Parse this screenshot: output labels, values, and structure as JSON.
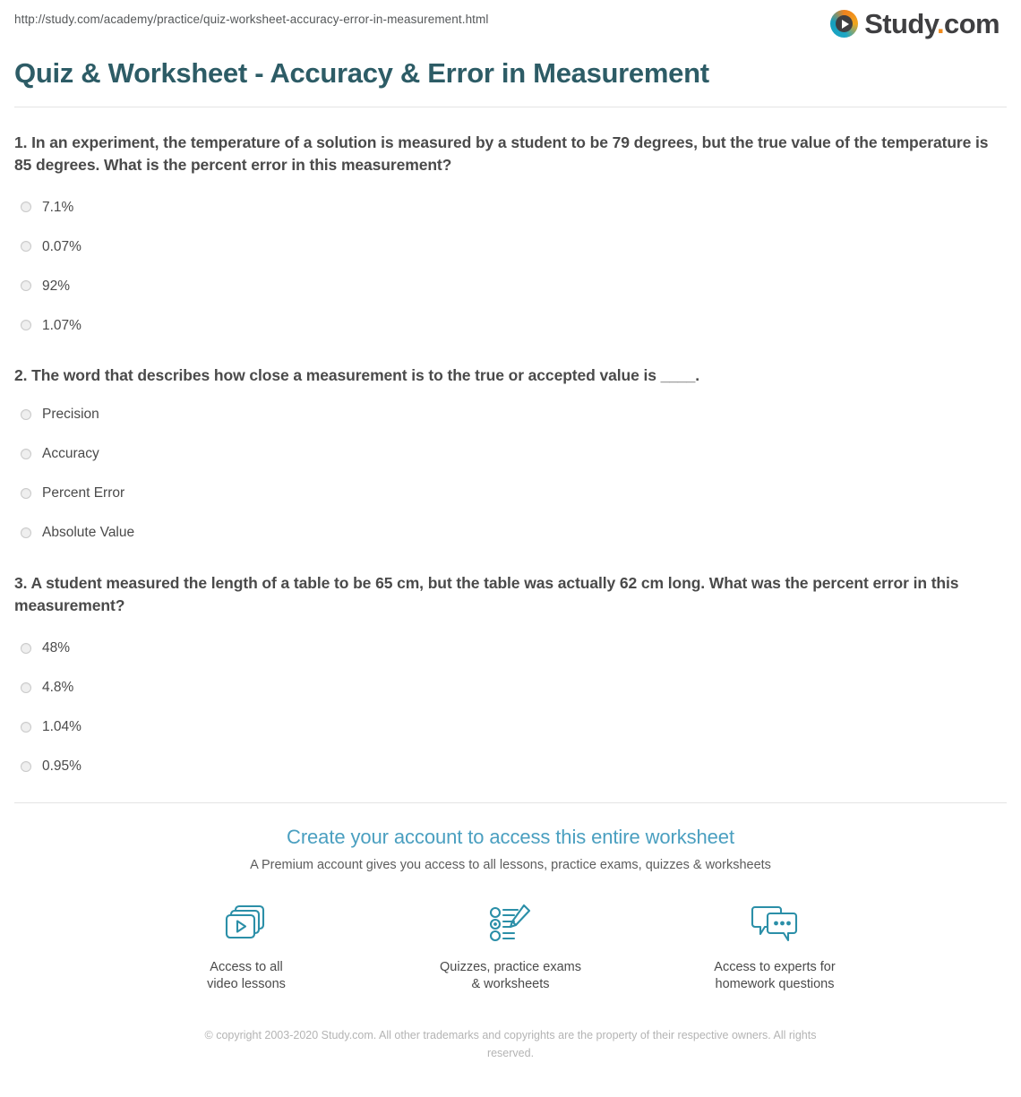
{
  "header": {
    "url": "http://study.com/academy/practice/quiz-worksheet-accuracy-error-in-measurement.html",
    "logo": {
      "icon": "play-circle-icon",
      "word": "Study",
      "dot": ".",
      "com": "com"
    }
  },
  "page_title": "Quiz & Worksheet - Accuracy & Error in Measurement",
  "questions": [
    {
      "text": "1. In an experiment, the temperature of a solution is measured by a student to be 79 degrees, but the true value of the temperature is 85 degrees. What is the percent error in this measurement?",
      "options": [
        "7.1%",
        "0.07%",
        "92%",
        "1.07%"
      ]
    },
    {
      "text": "2. The word that describes how close a measurement is to the true or accepted value is ____.",
      "options": [
        "Precision",
        "Accuracy",
        "Percent Error",
        "Absolute Value"
      ]
    },
    {
      "text": "3. A student measured the length of a table to be 65 cm, but the table was actually 62 cm long. What was the percent error in this measurement?",
      "options": [
        "48%",
        "4.8%",
        "1.04%",
        "0.95%"
      ]
    }
  ],
  "cta": {
    "title": "Create your account to access this entire worksheet",
    "subtitle": "A Premium account gives you access to all lessons, practice exams, quizzes & worksheets",
    "features": [
      {
        "icon": "video-lessons-icon",
        "label": "Access to all\nvideo lessons"
      },
      {
        "icon": "quiz-pencil-icon",
        "label": "Quizzes, practice exams\n& worksheets"
      },
      {
        "icon": "chat-bubbles-icon",
        "label": "Access to experts for\nhomework questions"
      }
    ]
  },
  "copyright": "© copyright 2003-2020 Study.com. All other trademarks and copyrights are the property of their respective owners. All rights reserved.",
  "colors": {
    "title": "#2d5c66",
    "cta_title": "#4a9fc0",
    "icon_teal": "#2b8fa8",
    "logo_orange": "#f08b1d",
    "body_text": "#4a4a4a",
    "copyright_text": "#b4b4b4"
  }
}
